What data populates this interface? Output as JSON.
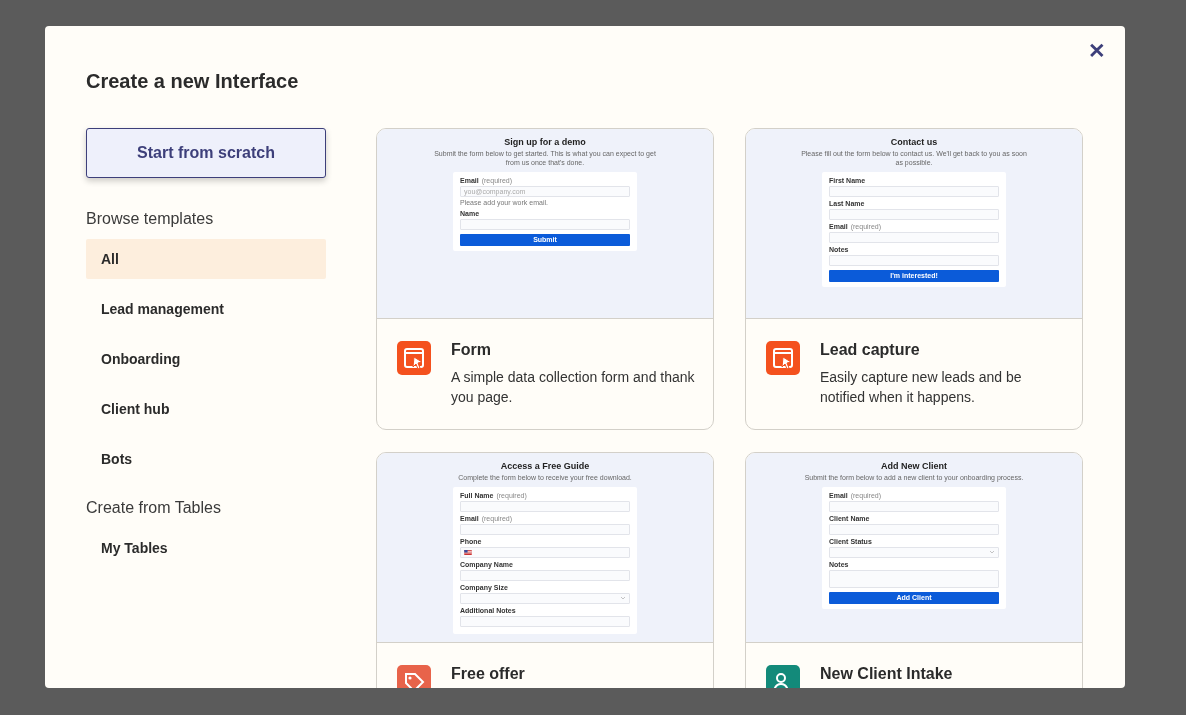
{
  "dialog": {
    "title": "Create a new Interface",
    "close": "✕"
  },
  "start_button": "Start from scratch",
  "sidebar": [
    {
      "heading": "Browse templates",
      "items": [
        {
          "label": "All",
          "selected": true
        },
        {
          "label": "Lead management",
          "selected": false
        },
        {
          "label": "Onboarding",
          "selected": false
        },
        {
          "label": "Client hub",
          "selected": false
        },
        {
          "label": "Bots",
          "selected": false
        }
      ]
    },
    {
      "heading": "Create from Tables",
      "items": [
        {
          "label": "My Tables",
          "selected": false
        }
      ]
    }
  ],
  "templates": [
    {
      "title": "Form",
      "description": "A simple data collection form and thank you page.",
      "kind": "form",
      "color": "#f4511e",
      "preview": {
        "heading": "Sign up for a demo",
        "intro": "Submit the form below to get started. This is what you can expect to get from us once that's done.",
        "fields": [
          {
            "kind": "input",
            "label": "Email",
            "hint": "(required)",
            "placeholder": "you@company.com",
            "help": "Please add your work email."
          },
          {
            "kind": "input",
            "label": "Name"
          }
        ],
        "button": "Submit"
      }
    },
    {
      "title": "Lead capture",
      "description": "Easily capture new leads and be notified when it happens.",
      "kind": "form",
      "color": "#f4511e",
      "preview": {
        "heading": "Contact us",
        "intro": "Please fill out the form below to contact us. We'll get back to you as soon as possible.",
        "fields": [
          {
            "kind": "input",
            "label": "First Name"
          },
          {
            "kind": "input",
            "label": "Last Name"
          },
          {
            "kind": "input",
            "label": "Email",
            "hint": "(required)"
          },
          {
            "kind": "input",
            "label": "Notes"
          }
        ],
        "button": "I'm interested!"
      }
    },
    {
      "title": "Free offer",
      "kind": "offer",
      "color": "#e8634a",
      "preview": {
        "heading": "Access a Free Guide",
        "intro": "Complete the form below to receive your free download.",
        "fields": [
          {
            "kind": "input",
            "label": "Full Name",
            "hint": "(required)"
          },
          {
            "kind": "input",
            "label": "Email",
            "hint": "(required)"
          },
          {
            "kind": "phone",
            "label": "Phone"
          },
          {
            "kind": "input",
            "label": "Company Name"
          },
          {
            "kind": "select",
            "label": "Company Size"
          },
          {
            "kind": "input",
            "label": "Additional Notes"
          }
        ]
      }
    },
    {
      "title": "New Client Intake",
      "kind": "client",
      "color": "#138a7a",
      "preview": {
        "heading": "Add New Client",
        "intro": "Submit the form below to add a new client to your onboarding process.",
        "fields": [
          {
            "kind": "input",
            "label": "Email",
            "hint": "(required)"
          },
          {
            "kind": "input",
            "label": "Client Name"
          },
          {
            "kind": "select",
            "label": "Client Status"
          },
          {
            "kind": "textarea",
            "label": "Notes"
          }
        ],
        "button": "Add Client"
      }
    }
  ]
}
